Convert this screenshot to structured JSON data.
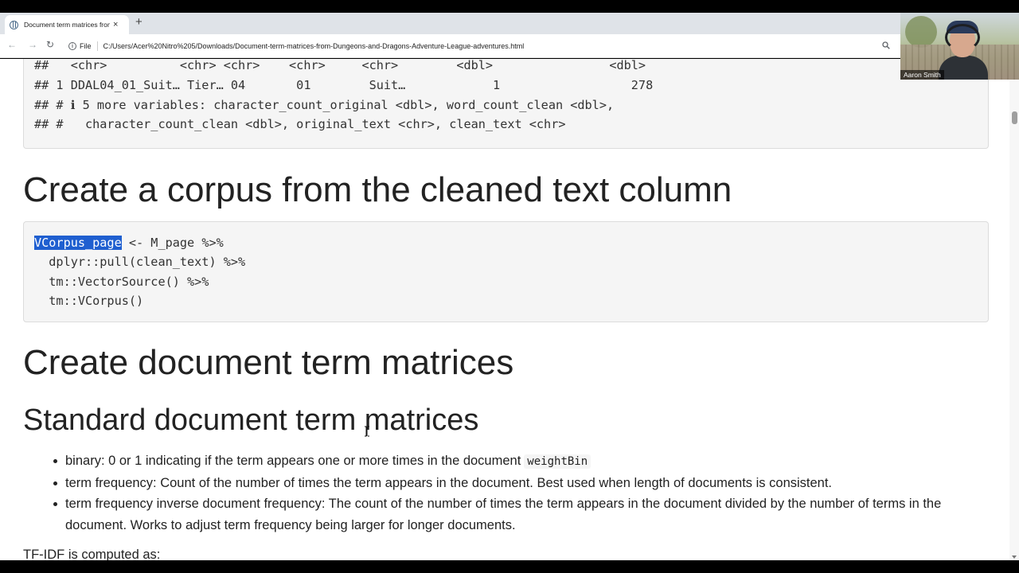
{
  "browser": {
    "tab_title": "Document term matrices from D",
    "tab_close": "×",
    "new_tab": "+",
    "scheme_label": "File",
    "url": "C:/Users/Acer%20Nitro%205/Downloads/Document-term-matrices-from-Dungeons-and-Dragons-Adventure-League-adventures.html"
  },
  "webcam": {
    "name": "Aaron Smith"
  },
  "output_block": {
    "lines": [
      "##   <chr>          <chr> <chr>    <chr>     <chr>        <dbl>                <dbl>",
      "## 1 DDAL04_01_Suit… Tier… 04       01        Suit…            1                  278",
      "## # ℹ 5 more variables: character_count_original <dbl>, word_count_clean <dbl>,",
      "## #   character_count_clean <dbl>, original_text <chr>, clean_text <chr>"
    ]
  },
  "heading_corpus": "Create a corpus from the cleaned text column",
  "code_block": {
    "selected": "VCorpus_page",
    "line1_rest": " <- M_page %>%",
    "line2": "  dplyr::pull(clean_text) %>%",
    "line3": "  tm::VectorSource() %>%",
    "line4": "  tm::VCorpus()"
  },
  "heading_dtm": "Create document term matrices",
  "heading_standard": "Standard document term matrices",
  "bullets": [
    {
      "text": "binary: 0 or 1 indicating if the term appears one or more times in the document",
      "code": "weightBin"
    },
    {
      "text": "term frequency: Count of the number of times the term appears in the document. Best used when length of documents is consistent."
    },
    {
      "text": "term frequency inverse document frequency: The count of the number of times the term appears in the document divided by the number of terms in the document. Works to adjust term frequency being larger for longer documents."
    }
  ],
  "tfidf_intro": "TF-IDF is computed as:"
}
